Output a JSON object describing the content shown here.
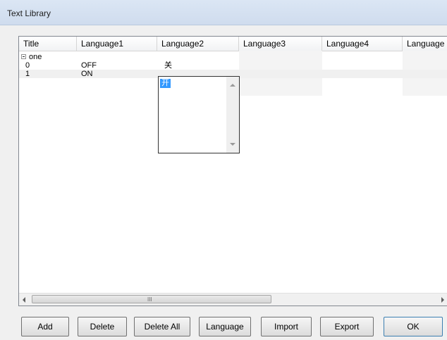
{
  "window": {
    "title": "Text Library"
  },
  "table": {
    "columns": [
      "Title",
      "Language1",
      "Language2",
      "Language3",
      "Language4",
      "Language"
    ],
    "group": {
      "title": "one"
    },
    "rows": [
      {
        "title": "0",
        "language1": "OFF",
        "language2": "关"
      },
      {
        "title": "1",
        "language1": "ON",
        "language2": ""
      }
    ]
  },
  "dropdown": {
    "items": [
      "开"
    ]
  },
  "scrollbar": {
    "grip": "III"
  },
  "buttons": {
    "add": "Add",
    "delete": "Delete",
    "delete_all": "Delete All",
    "language": "Language",
    "import": "Import",
    "export": "Export",
    "ok": "OK"
  }
}
